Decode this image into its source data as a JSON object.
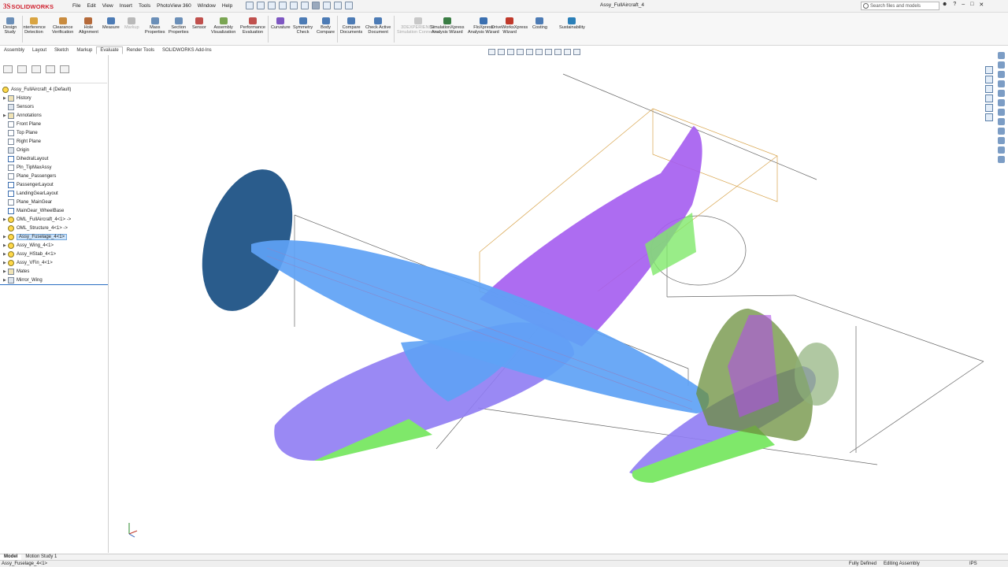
{
  "app": {
    "brand": "SOLIDWORKS",
    "brand_prefix": "3S",
    "doc_title": "Assy_FullAircraft_4"
  },
  "menu": [
    "File",
    "Edit",
    "View",
    "Insert",
    "Tools",
    "PhotoView 360",
    "Window",
    "Help"
  ],
  "search": {
    "placeholder": "Search files and models"
  },
  "ribbon": {
    "tools": [
      {
        "label1": "Design",
        "label2": "Study",
        "icon": "design-study-icon",
        "color": "#6b8fb8"
      },
      {
        "label1": "Interference",
        "label2": "Detection",
        "icon": "interference-icon",
        "color": "#d9a441"
      },
      {
        "label1": "Clearance",
        "label2": "Verification",
        "icon": "clearance-icon",
        "color": "#c98b3e"
      },
      {
        "label1": "Hole",
        "label2": "Alignment",
        "icon": "hole-alignment-icon",
        "color": "#b56a3a"
      },
      {
        "label1": "Measure",
        "label2": "",
        "icon": "measure-icon",
        "color": "#4c7bb5"
      },
      {
        "label1": "Markup",
        "label2": "",
        "icon": "markup-icon",
        "color": "#b9b9b9"
      },
      {
        "label1": "Mass",
        "label2": "Properties",
        "icon": "mass-properties-icon",
        "color": "#6b8fb8"
      },
      {
        "label1": "Section",
        "label2": "Properties",
        "icon": "section-properties-icon",
        "color": "#6b8fb8"
      },
      {
        "label1": "Sensor",
        "label2": "",
        "icon": "sensor-icon",
        "color": "#c0504d"
      },
      {
        "label1": "Assembly",
        "label2": "Visualization",
        "icon": "assembly-visualization-icon",
        "color": "#7aa552"
      },
      {
        "label1": "Performance",
        "label2": "Evaluation",
        "icon": "performance-icon",
        "color": "#c0504d"
      },
      {
        "label1": "Curvature",
        "label2": "",
        "icon": "curvature-icon",
        "color": "#7e57c2"
      },
      {
        "label1": "Symmetry",
        "label2": "Check",
        "icon": "symmetry-icon",
        "color": "#4c7bb5"
      },
      {
        "label1": "Body",
        "label2": "Compare",
        "icon": "body-compare-icon",
        "color": "#4c7bb5"
      },
      {
        "label1": "Compare",
        "label2": "Documents",
        "icon": "compare-docs-icon",
        "color": "#4c7bb5"
      },
      {
        "label1": "Check Active",
        "label2": "Document",
        "icon": "check-doc-icon",
        "color": "#4c7bb5"
      },
      {
        "label1": "3DEXPERIENCE",
        "label2": "Simulation Connector",
        "icon": "3dx-icon",
        "color": "#c8c8c8"
      },
      {
        "label1": "SimulationXpress",
        "label2": "Analysis Wizard",
        "icon": "simxpress-icon",
        "color": "#3a7d44"
      },
      {
        "label1": "FloXpress",
        "label2": "Analysis Wizard",
        "icon": "floxpress-icon",
        "color": "#3a6fb0"
      },
      {
        "label1": "DriveWorksXpress",
        "label2": "Wizard",
        "icon": "driveworks-icon",
        "color": "#c0392b"
      },
      {
        "label1": "Costing",
        "label2": "",
        "icon": "costing-icon",
        "color": "#4c7bb5"
      },
      {
        "label1": "Sustainability",
        "label2": "",
        "icon": "sustainability-icon",
        "color": "#2a7fb8"
      }
    ]
  },
  "tabs": [
    "Assembly",
    "Layout",
    "Sketch",
    "Markup",
    "Evaluate",
    "Render Tools",
    "SOLIDWORKS Add-Ins"
  ],
  "active_tab": "Evaluate",
  "tree": {
    "root": "Assy_FullAircraft_4  (Default)",
    "items": [
      {
        "label": "History",
        "icon": "history-icon",
        "expandable": true
      },
      {
        "label": "Sensors",
        "icon": "sensors-icon",
        "expandable": false
      },
      {
        "label": "Annotations",
        "icon": "annotations-icon",
        "expandable": true
      },
      {
        "label": "Front Plane",
        "icon": "plane-icon",
        "expandable": false
      },
      {
        "label": "Top Plane",
        "icon": "plane-icon",
        "expandable": false
      },
      {
        "label": "Right Plane",
        "icon": "plane-icon",
        "expandable": false
      },
      {
        "label": "Origin",
        "icon": "origin-icon",
        "expandable": false
      },
      {
        "label": "DihedralLayout",
        "icon": "sketch-icon",
        "expandable": false
      },
      {
        "label": "Pln_TipMaxAssy",
        "icon": "plane-icon",
        "expandable": false
      },
      {
        "label": "Plane_Passengers",
        "icon": "plane-icon",
        "expandable": false
      },
      {
        "label": "PassengerLayout",
        "icon": "sketch-icon",
        "expandable": false
      },
      {
        "label": "LandingGearLayout",
        "icon": "sketch-icon",
        "expandable": false
      },
      {
        "label": "Plane_MainGear",
        "icon": "plane-icon",
        "expandable": false
      },
      {
        "label": "MainGear_WheelBase",
        "icon": "sketch-icon",
        "expandable": false
      },
      {
        "label": "OML_FullAircraft_4<1> ->",
        "icon": "part-icon",
        "expandable": true
      },
      {
        "label": "OML_Structure_4<1> ->",
        "icon": "part-icon",
        "expandable": false
      },
      {
        "label": "Assy_Fuselage_4<1>",
        "icon": "assembly-icon",
        "expandable": true,
        "selected": true
      },
      {
        "label": "Assy_Wing_4<1>",
        "icon": "assembly-icon",
        "expandable": true
      },
      {
        "label": "Assy_HStab_4<1>",
        "icon": "assembly-icon",
        "expandable": true
      },
      {
        "label": "Assy_VFin_4<1>",
        "icon": "assembly-icon",
        "expandable": true
      },
      {
        "label": "Mates",
        "icon": "mates-icon",
        "expandable": true
      },
      {
        "label": "Mirror_Wing",
        "icon": "mirror-icon",
        "expandable": true
      }
    ]
  },
  "bottom_tabs": [
    "Model",
    "Motion Study 1"
  ],
  "status": {
    "selection": "Assy_Fuselage_4<1>",
    "definition": "Fully Defined",
    "mode": "Editing Assembly",
    "units": "IPS"
  },
  "colors": {
    "wing_purple": "#8f7cf3",
    "fuselage_blue": "#5ea2f5",
    "tail_magenta": "#b04ee8",
    "green_surface": "#7fe86a",
    "propeller": "#2a5c8c"
  }
}
